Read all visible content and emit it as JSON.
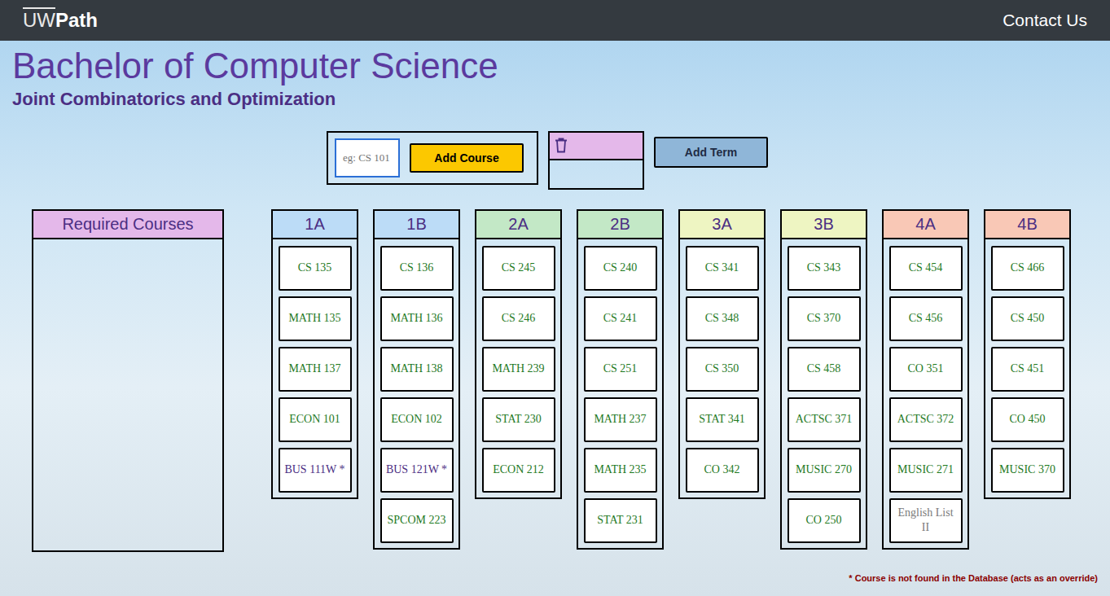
{
  "nav": {
    "logo_prefix": "UW",
    "logo_suffix": "Path",
    "contact": "Contact Us"
  },
  "title": "Bachelor of Computer Science",
  "subtitle": "Joint Combinatorics and Optimization",
  "course_input": {
    "placeholder": "eg: CS 101",
    "button": "Add Course"
  },
  "add_term": "Add Term",
  "required": {
    "title": "Required Courses",
    "courses": []
  },
  "terms": [
    {
      "name": "1A",
      "color": "#bcdcf7",
      "courses": [
        {
          "code": "CS 135",
          "color": "#1f7a1f"
        },
        {
          "code": "MATH 135",
          "color": "#1f7a1f"
        },
        {
          "code": "MATH 137",
          "color": "#1f7a1f"
        },
        {
          "code": "ECON 101",
          "color": "#1f7a1f"
        },
        {
          "code": "BUS 111W *",
          "color": "#4b2e83"
        }
      ]
    },
    {
      "name": "1B",
      "color": "#bcdcf7",
      "courses": [
        {
          "code": "CS 136",
          "color": "#1f7a1f"
        },
        {
          "code": "MATH 136",
          "color": "#1f7a1f"
        },
        {
          "code": "MATH 138",
          "color": "#1f7a1f"
        },
        {
          "code": "ECON 102",
          "color": "#1f7a1f"
        },
        {
          "code": "BUS 121W *",
          "color": "#4b2e83"
        },
        {
          "code": "SPCOM 223",
          "color": "#1f7a1f"
        }
      ]
    },
    {
      "name": "2A",
      "color": "#c3e8c6",
      "courses": [
        {
          "code": "CS 245",
          "color": "#1f7a1f"
        },
        {
          "code": "CS 246",
          "color": "#1f7a1f"
        },
        {
          "code": "MATH 239",
          "color": "#1f7a1f"
        },
        {
          "code": "STAT 230",
          "color": "#1f7a1f"
        },
        {
          "code": "ECON 212",
          "color": "#1f7a1f"
        }
      ]
    },
    {
      "name": "2B",
      "color": "#c3e8c6",
      "courses": [
        {
          "code": "CS 240",
          "color": "#1f7a1f"
        },
        {
          "code": "CS 241",
          "color": "#1f7a1f"
        },
        {
          "code": "CS 251",
          "color": "#1f7a1f"
        },
        {
          "code": "MATH 237",
          "color": "#1f7a1f"
        },
        {
          "code": "MATH 235",
          "color": "#1f7a1f"
        },
        {
          "code": "STAT 231",
          "color": "#1f7a1f"
        }
      ]
    },
    {
      "name": "3A",
      "color": "#eef5c2",
      "courses": [
        {
          "code": "CS 341",
          "color": "#1f7a1f"
        },
        {
          "code": "CS 348",
          "color": "#1f7a1f"
        },
        {
          "code": "CS 350",
          "color": "#1f7a1f"
        },
        {
          "code": "STAT 341",
          "color": "#1f7a1f"
        },
        {
          "code": "CO 342",
          "color": "#1f7a1f"
        }
      ]
    },
    {
      "name": "3B",
      "color": "#eef5c2",
      "courses": [
        {
          "code": "CS 343",
          "color": "#1f7a1f"
        },
        {
          "code": "CS 370",
          "color": "#1f7a1f"
        },
        {
          "code": "CS 458",
          "color": "#1f7a1f"
        },
        {
          "code": "ACTSC 371",
          "color": "#1f7a1f"
        },
        {
          "code": "MUSIC 270",
          "color": "#1f7a1f"
        },
        {
          "code": "CO 250",
          "color": "#1f7a1f"
        }
      ]
    },
    {
      "name": "4A",
      "color": "#f9c8b6",
      "courses": [
        {
          "code": "CS 454",
          "color": "#1f7a1f"
        },
        {
          "code": "CS 456",
          "color": "#1f7a1f"
        },
        {
          "code": "CO 351",
          "color": "#1f7a1f"
        },
        {
          "code": "ACTSC 372",
          "color": "#1f7a1f"
        },
        {
          "code": "MUSIC 271",
          "color": "#1f7a1f"
        },
        {
          "code": "English List II",
          "color": "#7a7a7a"
        }
      ]
    },
    {
      "name": "4B",
      "color": "#f9c8b6",
      "courses": [
        {
          "code": "CS 466",
          "color": "#1f7a1f"
        },
        {
          "code": "CS 450",
          "color": "#1f7a1f"
        },
        {
          "code": "CS 451",
          "color": "#1f7a1f"
        },
        {
          "code": "CO 450",
          "color": "#1f7a1f"
        },
        {
          "code": "MUSIC 370",
          "color": "#1f7a1f"
        }
      ]
    }
  ],
  "footnote": "* Course is not found in the Database (acts as an override)"
}
